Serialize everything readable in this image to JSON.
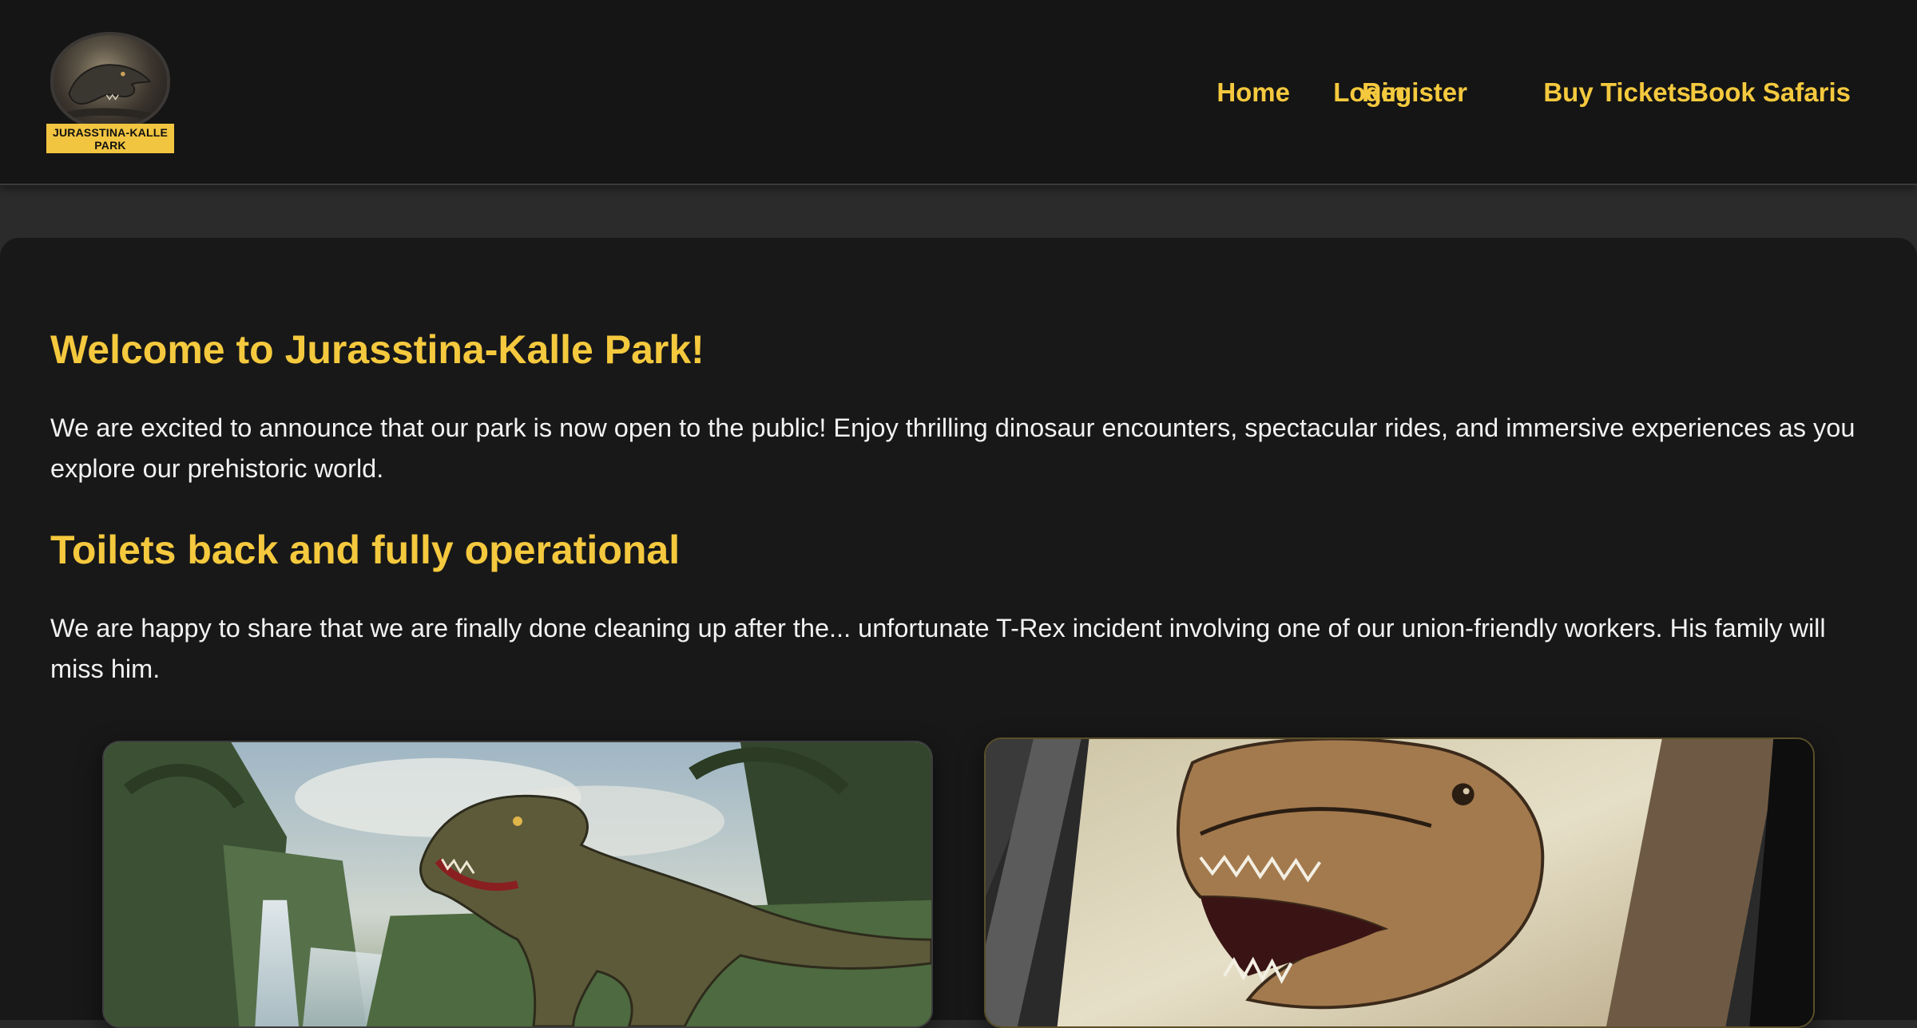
{
  "brand": {
    "logo_text": "JURASSTINA-KALLE PARK",
    "accent_color": "#f5c93e",
    "label_color": "#f2c541"
  },
  "nav": {
    "items": [
      {
        "label": "Home"
      },
      {
        "label": "Register"
      },
      {
        "label": "Login"
      },
      {
        "label": "Buy Tickets"
      },
      {
        "label": "Book Safaris"
      }
    ]
  },
  "main": {
    "welcome_title": "Welcome to Jurasstina-Kalle Park!",
    "welcome_text": "We are excited to announce that our park is now open to the public! Enjoy thrilling dinosaur encounters, spectacular rides, and immersive experiences as you explore our prehistoric world.",
    "news_title": "Toilets back and fully operational",
    "news_text": "We are happy to share that we are finally done cleaning up after the... unfortunate T-Rex incident involving one of our union-friendly workers. His family will miss him."
  },
  "images": [
    {
      "icon": "trex-jungle-waterfall-image"
    },
    {
      "icon": "trex-head-sketch-image"
    }
  ]
}
